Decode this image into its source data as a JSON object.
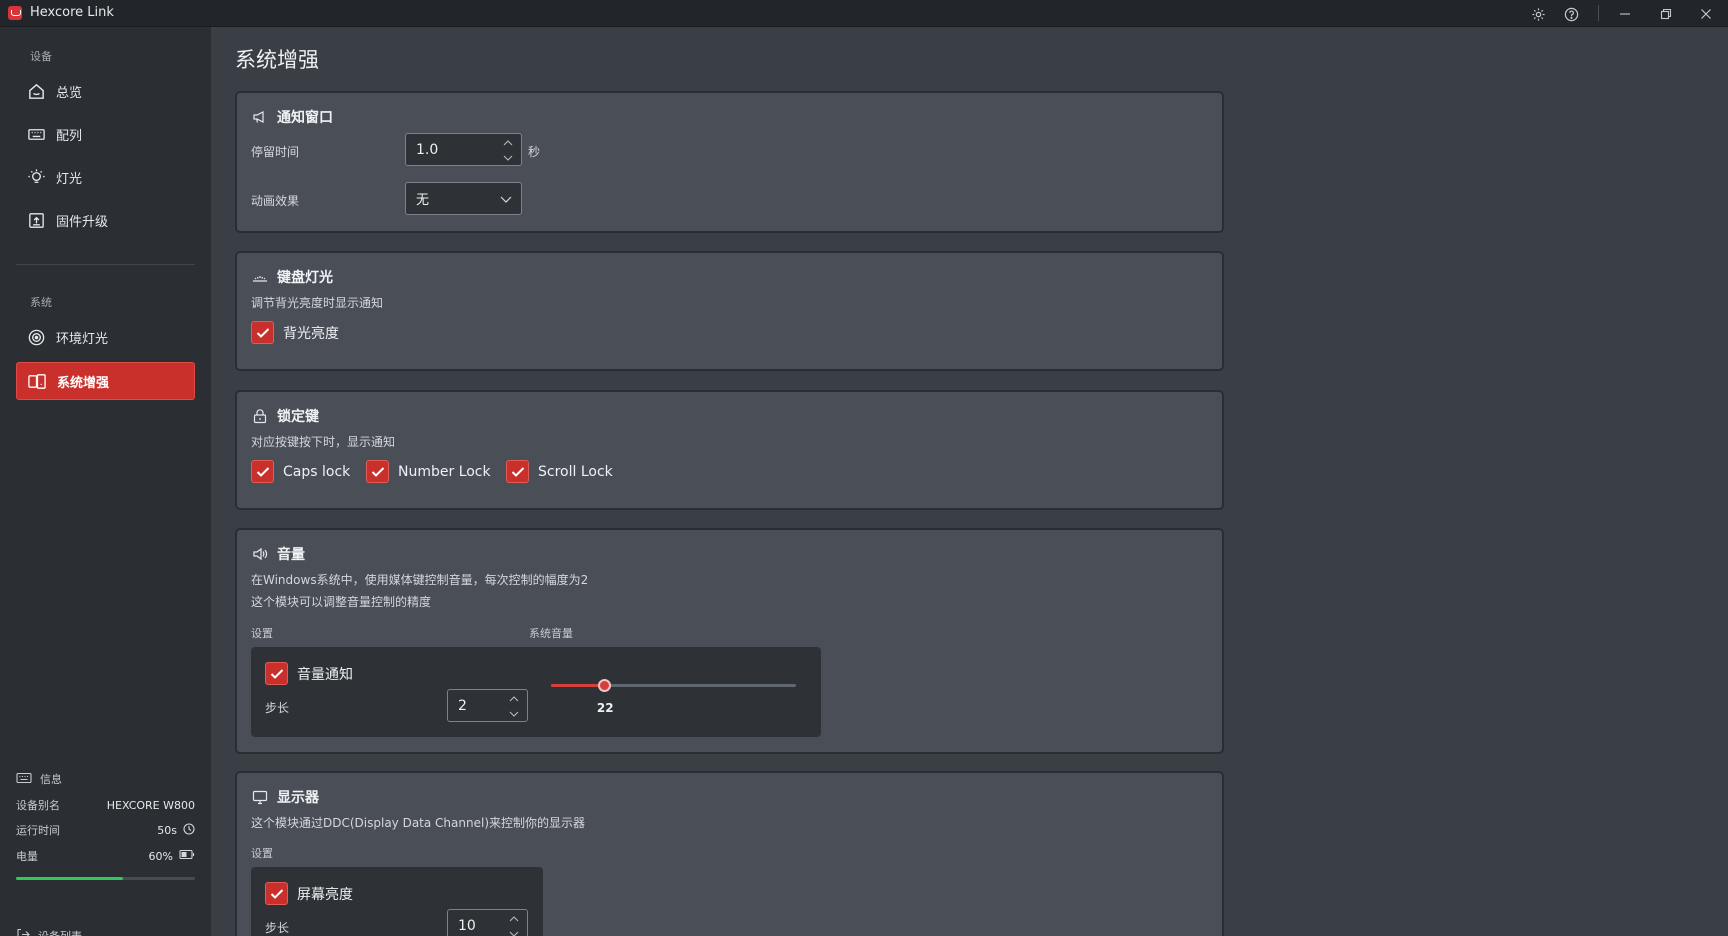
{
  "window": {
    "title": "Hexcore Link",
    "icons": [
      "settings-icon",
      "help-icon",
      "minimize-icon",
      "restore-icon",
      "close-icon"
    ]
  },
  "sidebar": {
    "device_section": "设备",
    "device_items": [
      {
        "label": "总览",
        "icon": "home-icon"
      },
      {
        "label": "配列",
        "icon": "keyboard-icon"
      },
      {
        "label": "灯光",
        "icon": "bulb-icon"
      },
      {
        "label": "固件升级",
        "icon": "upgrade-icon"
      }
    ],
    "system_section": "系统",
    "system_items": [
      {
        "label": "环境灯光",
        "icon": "ambient-icon"
      },
      {
        "label": "系统增强",
        "icon": "system-enhance-icon",
        "active": true
      }
    ],
    "info": {
      "title": "信息",
      "alias_label": "设备别名",
      "alias_value": "HEXCORE W800",
      "uptime_label": "运行时间",
      "uptime_value": "50s",
      "battery_label": "电量",
      "battery_value": "60%",
      "battery_level": 0.6
    },
    "device_list_label": "设备列表"
  },
  "page": {
    "title": "系统增强",
    "notify_window": {
      "title": "通知窗口",
      "duration_label": "停留时间",
      "duration_value": "1.0",
      "duration_unit": "秒",
      "animation_label": "动画效果",
      "animation_value": "无"
    },
    "keyboard_light": {
      "title": "键盘灯光",
      "desc": "调节背光亮度时显示通知",
      "backlight_label": "背光亮度"
    },
    "lock_keys": {
      "title": "锁定键",
      "desc": "对应按键按下时，显示通知",
      "options": [
        "Caps lock",
        "Number Lock",
        "Scroll Lock"
      ]
    },
    "volume": {
      "title": "音量",
      "desc1": "在Windows系统中，使用媒体键控制音量，每次控制的幅度为2",
      "desc2": "这个模块可以调整音量控制的精度",
      "settings_label": "设置",
      "system_volume_label": "系统音量",
      "notify_label": "音量通知",
      "step_label": "步长",
      "step_value": "2",
      "system_volume_value": "22",
      "system_volume_level": 0.22
    },
    "display": {
      "title": "显示器",
      "desc": "这个模块通过DDC(Display Data Channel)来控制你的显示器",
      "settings_label": "设置",
      "brightness_label": "屏幕亮度",
      "step_label": "步长",
      "step_value": "10"
    }
  }
}
